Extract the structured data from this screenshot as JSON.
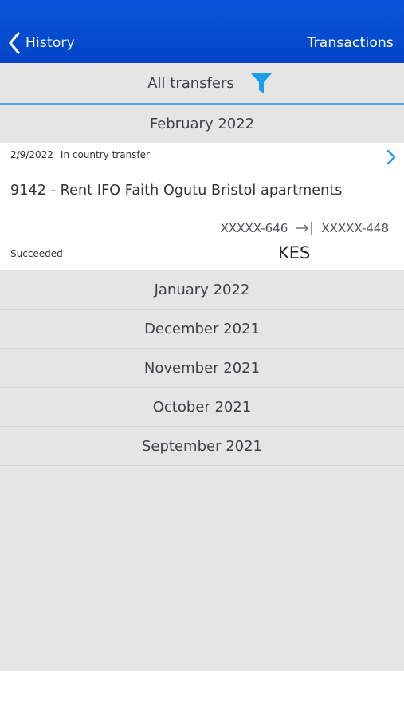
{
  "header": {
    "back_label": "History",
    "title": "Transactions"
  },
  "filter": {
    "label": "All transfers",
    "icon": "filter-icon",
    "accent_color": "#1a9ee8"
  },
  "current_month": {
    "label": "February 2022",
    "transaction": {
      "date": "2/9/2022",
      "type": "In country transfer",
      "description": "9142 - Rent IFO Faith Ogutu Bristol apartments",
      "from_account": "XXXXX-646",
      "to_account": "XXXXX-448",
      "status": "Succeeded",
      "currency": "KES"
    }
  },
  "months": [
    {
      "label": "January 2022"
    },
    {
      "label": "December 2021"
    },
    {
      "label": "November 2021"
    },
    {
      "label": "October 2021"
    },
    {
      "label": "September 2021"
    }
  ],
  "colors": {
    "header": "#0044c6",
    "background": "#e5e5e5",
    "divider_accent": "#5aa7e6"
  }
}
